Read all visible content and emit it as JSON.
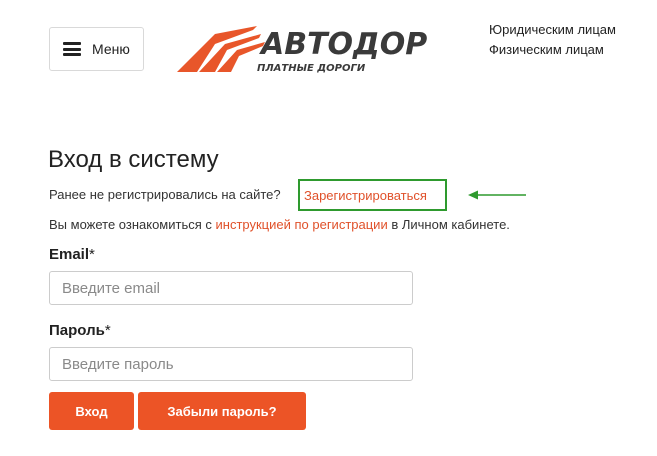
{
  "header": {
    "menu_label": "Меню",
    "logo": {
      "brand": "АВТОДОР",
      "tagline": "ПЛАТНЫЕ ДОРОГИ"
    },
    "links": [
      "Юридическим лицам",
      "Физическим лицам"
    ]
  },
  "login": {
    "title": "Вход в систему",
    "not_registered_text": "Ранее не регистрировались на сайте?",
    "register_link": "Зарегистрироваться",
    "info_prefix": "Вы можете ознакомиться с ",
    "info_link": "инструкцией по регистрации",
    "info_suffix": " в Личном кабинете.",
    "email_label": "Email",
    "email_placeholder": "Введите email",
    "password_label": "Пароль",
    "password_placeholder": "Введите пароль",
    "required_mark": "*",
    "submit_label": "Вход",
    "forgot_label": "Забыли пароль?"
  },
  "colors": {
    "accent": "#ec5426",
    "link": "#e0512a",
    "highlight": "#2e9a2e"
  }
}
